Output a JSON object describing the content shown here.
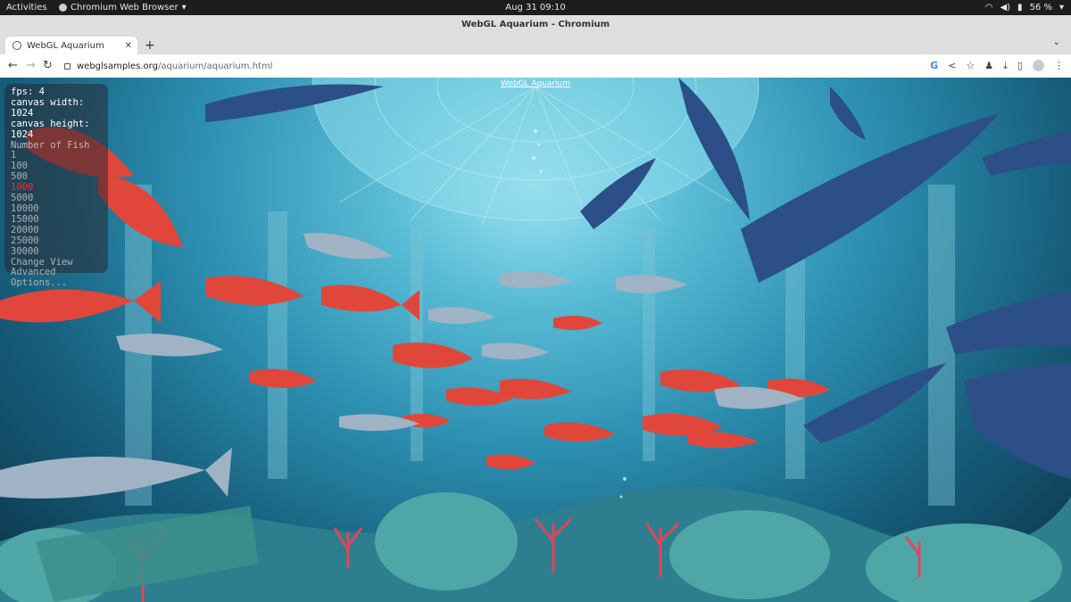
{
  "system_bar": {
    "activities": "Activities",
    "app_menu": "Chromium Web Browser",
    "clock": "Aug 31  09:10",
    "battery": "56 %"
  },
  "window": {
    "title": "WebGL Aquarium - Chromium"
  },
  "tabs": [
    {
      "label": "WebGL Aquarium",
      "active": true
    }
  ],
  "address_bar": {
    "host": "webglsamples.org",
    "path": "/aquarium/aquarium.html"
  },
  "page": {
    "title_link": "WebGL Aquarium",
    "hud": {
      "fps": "fps: 4",
      "canvas_width": "canvas width: 1024",
      "canvas_height": "canvas height: 1024",
      "fish_label": "Number of Fish",
      "fish_options": [
        "1",
        "100",
        "500",
        "1000",
        "5000",
        "10000",
        "15000",
        "20000",
        "25000",
        "30000"
      ],
      "selected_option": "1000",
      "change_view": "Change View",
      "advanced": "Advanced",
      "options": "Options..."
    }
  },
  "colors": {
    "selected_option": "#ff2a2a",
    "water": "#2c8fb0",
    "red_fish": "#e0473a",
    "blue_fish": "#2b4f86"
  },
  "icons": [
    "globe-icon",
    "close-icon",
    "plus-icon",
    "back-icon",
    "forward-icon",
    "reload-icon",
    "lock-icon",
    "google-icon",
    "share-icon",
    "star-icon",
    "extension-icon",
    "download-icon",
    "sidepanel-icon",
    "profile-icon",
    "menu-icon",
    "wifi-icon",
    "volume-icon",
    "battery-icon"
  ]
}
